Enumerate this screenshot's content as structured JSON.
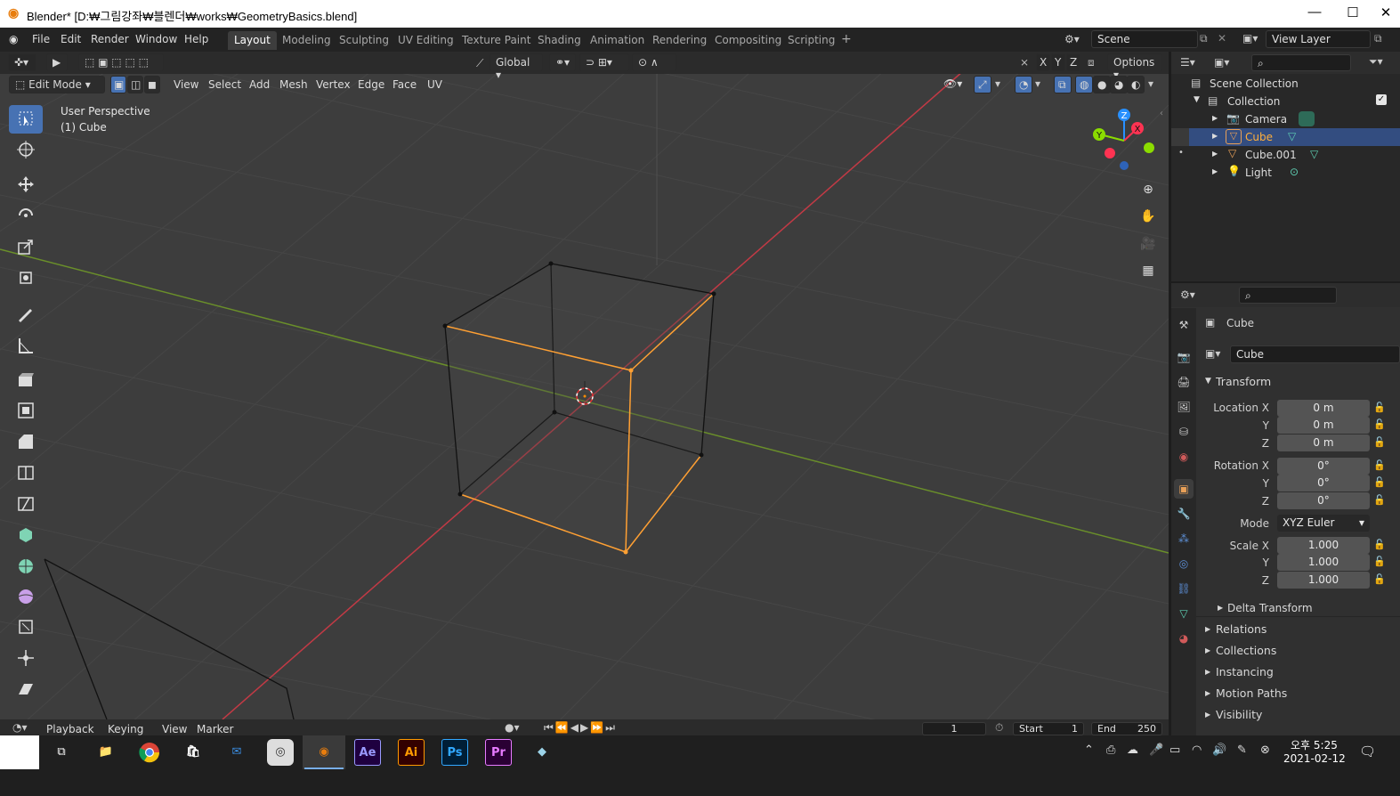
{
  "window": {
    "title": "Blender* [D:₩그림강좌₩블렌더₩works₩GeometryBasics.blend]",
    "minimize": "—",
    "maximize": "☐",
    "close": "✕"
  },
  "menu": [
    "File",
    "Edit",
    "Render",
    "Window",
    "Help"
  ],
  "workspaces": [
    "Layout",
    "Modeling",
    "Sculpting",
    "UV Editing",
    "Texture Paint",
    "Shading",
    "Animation",
    "Rendering",
    "Compositing",
    "Scripting"
  ],
  "active_workspace": "Layout",
  "add_workspace": "+",
  "scene": {
    "name": "Scene",
    "view_layer": "View Layer"
  },
  "viewport_header": {
    "transform_orientation": "Global",
    "axes": [
      "X",
      "Y",
      "Z"
    ],
    "options_label": "Options",
    "mode": "Edit Mode",
    "menus": [
      "View",
      "Select",
      "Add",
      "Mesh",
      "Vertex",
      "Edge",
      "Face",
      "UV"
    ]
  },
  "viewport_overlay": {
    "perspective": "User Perspective",
    "object": "(1) Cube"
  },
  "gizmo_axes": {
    "z": "Z",
    "x": "X",
    "y": "Y"
  },
  "tools": [
    "select-box",
    "cursor",
    "move",
    "rotate",
    "scale",
    "transform",
    "annotate",
    "measure",
    "extrude",
    "inset",
    "bevel",
    "loop-cut",
    "knife",
    "poly-build",
    "spin",
    "smooth",
    "edge-slide",
    "shrink-fatten",
    "shear"
  ],
  "outliner": {
    "root": "Scene Collection",
    "collection": "Collection",
    "items": [
      {
        "name": "Camera",
        "icon": "camera-icon",
        "selected": false
      },
      {
        "name": "Cube",
        "icon": "mesh-icon",
        "selected": true
      },
      {
        "name": "Cube.001",
        "icon": "mesh-icon",
        "selected": false
      },
      {
        "name": "Light",
        "icon": "light-icon",
        "selected": false
      }
    ]
  },
  "properties": {
    "object_name": "Cube",
    "data_name": "Cube",
    "transform_title": "Transform",
    "location_label": "Location X",
    "rotation_label": "Rotation X",
    "scale_label": "Scale X",
    "y_label": "Y",
    "z_label": "Z",
    "location": [
      "0 m",
      "0 m",
      "0 m"
    ],
    "rotation": [
      "0°",
      "0°",
      "0°"
    ],
    "mode_label": "Mode",
    "mode_value": "XYZ Euler",
    "scale": [
      "1.000",
      "1.000",
      "1.000"
    ],
    "delta_transform": "Delta Transform",
    "panels": [
      "Relations",
      "Collections",
      "Instancing",
      "Motion Paths",
      "Visibility"
    ]
  },
  "timeline": {
    "menus": [
      "Playback",
      "Keying",
      "View",
      "Marker"
    ],
    "current_frame": "1",
    "start_label": "Start",
    "start_value": "1",
    "end_label": "End",
    "end_value": "250"
  },
  "taskbar": {
    "apps": [
      "Ae",
      "Ai",
      "Ps",
      "Pr"
    ],
    "time": "오후 5:25",
    "date": "2021-02-12"
  },
  "colors": {
    "accent_blue": "#4772b3",
    "x_axis": "#ff3352",
    "y_axis": "#8bdc00",
    "z_axis": "#2890ff",
    "selection_orange": "#ffa033"
  }
}
